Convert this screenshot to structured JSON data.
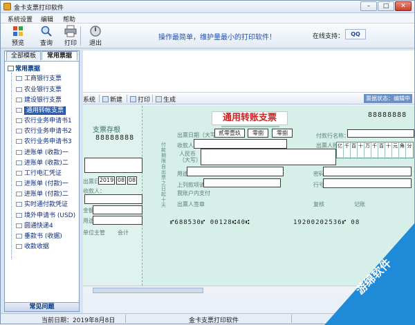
{
  "window": {
    "title": "金卡支票打印软件"
  },
  "menu": [
    "系统设置",
    "编辑",
    "帮助"
  ],
  "toolbar": {
    "buttons": [
      {
        "label": "预览",
        "icon": "preview-icon"
      },
      {
        "label": "查询",
        "icon": "query-icon"
      },
      {
        "label": "打印",
        "icon": "printer-icon"
      },
      {
        "label": "退出",
        "icon": "exit-icon"
      }
    ],
    "slogan": "操作最简单，维护量最小的打印软件！",
    "support_label": "在线支持：",
    "qq_label": "QQ"
  },
  "leftpanel": {
    "tabs": [
      "全部模板",
      "常用票据"
    ],
    "root": "常用票据",
    "items": [
      "工商银行支票",
      "农业银行支票",
      "建设银行支票",
      "通用转帐支票",
      "农行业务申请书1",
      "农行业务申请书2",
      "农行业务申请书3",
      "进账单 (收款)一",
      "进账单 (收款)二",
      "工行电汇凭证",
      "进账单 (付款)一",
      "进账单 (付款)二",
      "实时通付款凭证",
      "境外申请书 (USD)",
      "圆通快递4",
      "垂款书 (收据)",
      "收款收据"
    ],
    "selected_index": 3,
    "bottom_label": "常见问题"
  },
  "subtoolbar": {
    "system_label": "系统",
    "new_label": "新建",
    "print_label": "打印",
    "generate_label": "生成",
    "status": "票据状态：编辑中"
  },
  "check": {
    "title": "通用转账支票",
    "stub_title": "支票存根",
    "stub_number": "88888888",
    "top_number": "88888888",
    "date_year_words": "贰零壹玖",
    "date_month_words": "零捌",
    "date_day_words": "零捌",
    "stub_date": [
      "2019",
      "08",
      "08"
    ],
    "labels": {
      "issue_date": "出票日期（大写）",
      "payee": "收款人：",
      "amount": "人民币\n（大写）",
      "use": "用途",
      "account_note": "上列款项请从",
      "my_account": "我账户内支付",
      "drawer_sign": "出票人签章",
      "review": "复核",
      "bookkeeping": "记账",
      "payer_bank": "付款行名称：",
      "drawer_account": "出票人账号：",
      "password": "密码",
      "line_no": "行号",
      "stub_payee": "收款人：",
      "stub_amount": "金额：",
      "stub_use": "用途：",
      "stub_manager": "单位主管",
      "stub_accountant": "会计",
      "stub_date_prefix": "出票日期",
      "vertical_note": "付款期限自出票之日起十天"
    },
    "digit_headers": [
      "亿",
      "千",
      "百",
      "十",
      "万",
      "千",
      "百",
      "十",
      "元",
      "角",
      "分"
    ],
    "micr_left": "⑈688530⑈ 00128⑆40⑆",
    "micr_right": "19200202536⑈ 08"
  },
  "statusbar": {
    "date": "当前日期：2019年8月8日",
    "app": "金卡支票打印软件"
  },
  "watermark": "游绵软件"
}
